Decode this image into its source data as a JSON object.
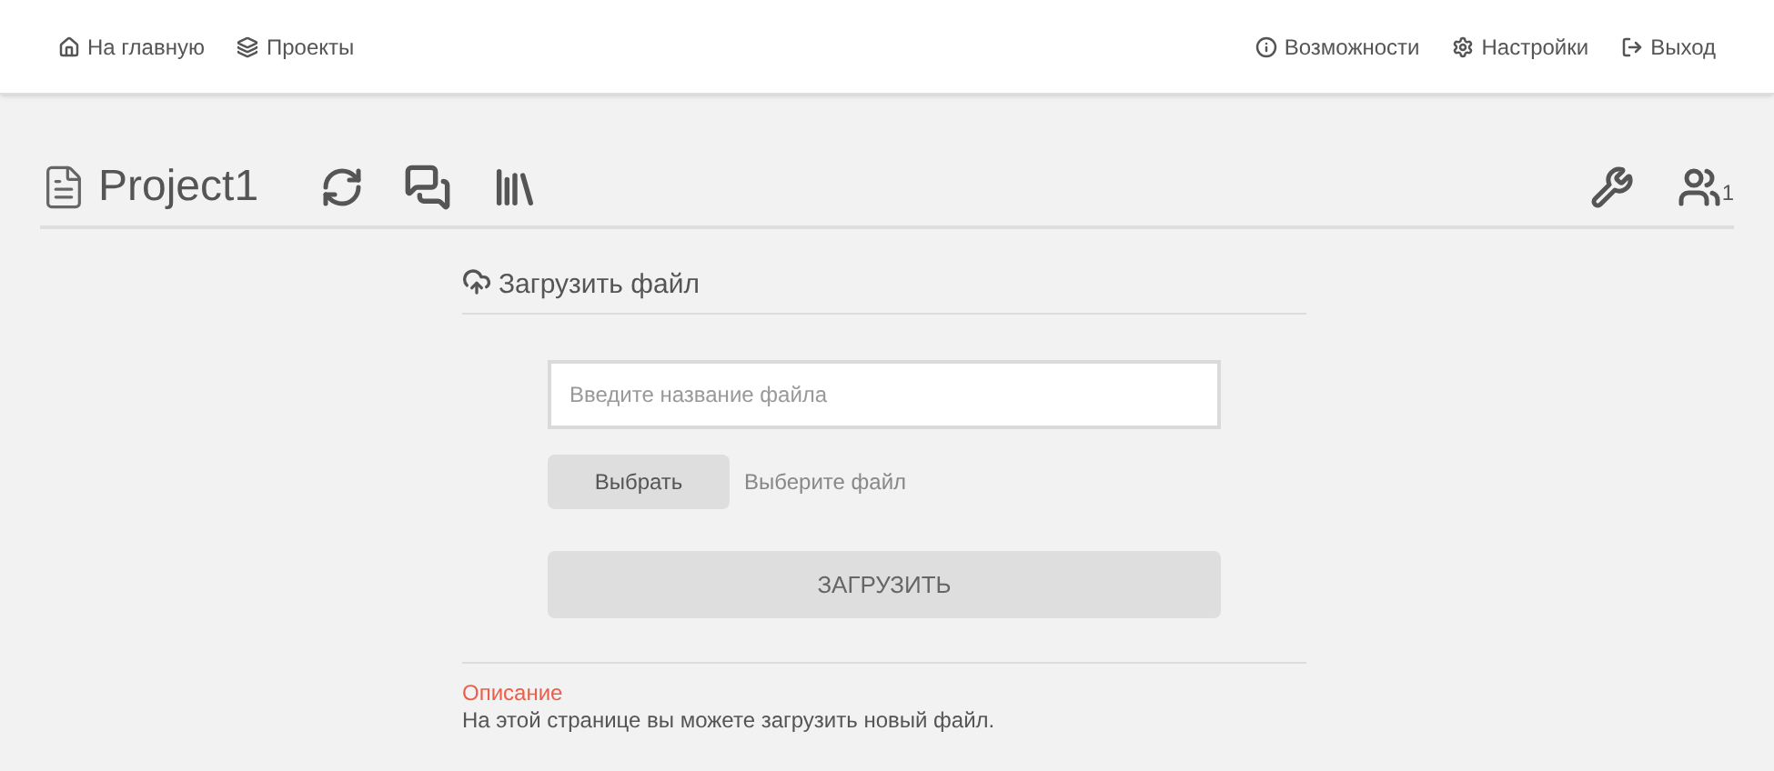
{
  "nav_left": [
    {
      "kind": "home",
      "label": "На главную"
    },
    {
      "kind": "projects",
      "label": "Проекты"
    }
  ],
  "nav_right": [
    {
      "kind": "info",
      "label": "Возможности"
    },
    {
      "kind": "settings",
      "label": "Настройки"
    },
    {
      "kind": "logout",
      "label": "Выход"
    }
  ],
  "project": {
    "title": "Project1",
    "member_count": "1"
  },
  "upload": {
    "title": "Загрузить файл",
    "name_field": {
      "placeholder": "Введите название файла"
    },
    "choose_button": "Выбрать",
    "file_status": "Выберите файл",
    "submit_button": "ЗАГРУЗИТЬ"
  },
  "description": {
    "heading": "Описание",
    "text": "На этой странице вы можете загрузить новый файл."
  }
}
